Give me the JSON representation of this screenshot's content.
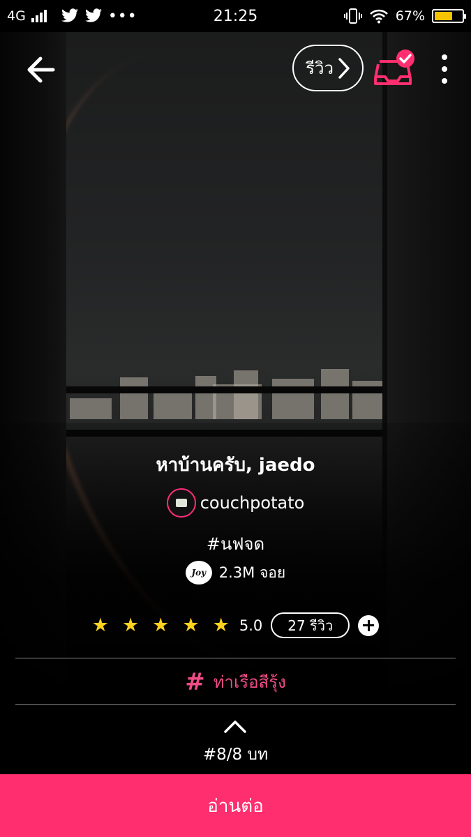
{
  "status_bar": {
    "network": "4G",
    "time": "21:25",
    "battery_percent": "67%",
    "battery_level": 0.67,
    "icons": [
      "signal-icon",
      "twitter-icon",
      "twitter-icon",
      "more-notifications-icon",
      "vibrate-icon",
      "wifi-icon",
      "battery-icon"
    ]
  },
  "header": {
    "review_label": "รีวิว",
    "icons": {
      "back": "arrow-left-icon",
      "inbox": "library-check-icon",
      "more": "more-vertical-icon"
    }
  },
  "story": {
    "title": "หาบ้านครับ, jaedo",
    "author": "couchpotato",
    "tag": "#นฟจด",
    "joy_badge": "Joy",
    "joy_count": "2.3M จอย",
    "rating": 5,
    "score": "5.0",
    "review_count": "27 รีวิว",
    "category": "ท่าเรือสีรุ้ง",
    "episode": "#8/8 บท"
  },
  "actions": {
    "continue_reading": "อ่านต่อ"
  },
  "colors": {
    "accent": "#ff2e6f",
    "category": "#f04c86",
    "star": "#ffd21f",
    "battery": "#f5c400"
  }
}
